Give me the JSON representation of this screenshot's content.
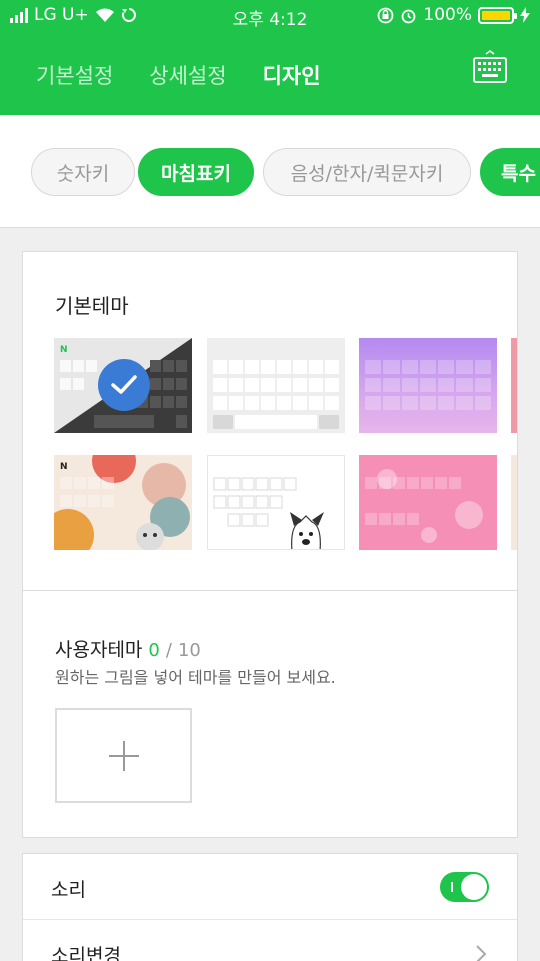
{
  "status_bar": {
    "carrier": "LG U+",
    "time": "오후 4:12",
    "battery": "100%",
    "battery_level": 1.0
  },
  "header": {
    "tabs": [
      {
        "label": "기본설정",
        "active": false
      },
      {
        "label": "상세설정",
        "active": false
      },
      {
        "label": "디자인",
        "active": true
      }
    ],
    "keyboard_icon": "keyboard-icon"
  },
  "chips": [
    {
      "label": "숫자키",
      "active": false
    },
    {
      "label": "마침표키",
      "active": true
    },
    {
      "label": "음성/한자/퀵문자키",
      "active": false
    },
    {
      "label": "특수",
      "active": false
    }
  ],
  "basic_themes": {
    "title": "기본테마",
    "themes": [
      {
        "name": "dark-diagonal",
        "selected": true
      },
      {
        "name": "light-gray",
        "selected": false
      },
      {
        "name": "purple-gradient",
        "selected": false
      },
      {
        "name": "beige-cat",
        "selected": false
      },
      {
        "name": "white-dog",
        "selected": false
      },
      {
        "name": "pink-flower",
        "selected": false
      }
    ]
  },
  "user_themes": {
    "title": "사용자테마",
    "count": "0",
    "separator": "/",
    "max": "10",
    "description": "원하는 그림을 넣어 테마를 만들어 보세요."
  },
  "settings": [
    {
      "label": "소리",
      "control": "toggle",
      "on": true
    },
    {
      "label": "소리변경",
      "control": "chevron"
    }
  ],
  "colors": {
    "accent": "#1ec54a",
    "check": "#3a7bd5"
  }
}
